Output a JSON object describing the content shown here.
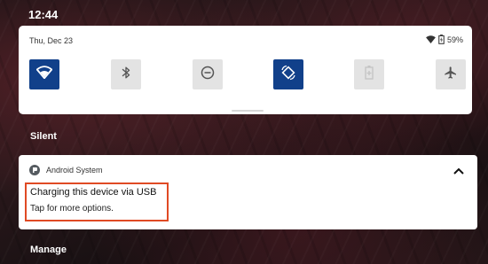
{
  "status_bar": {
    "time": "12:44"
  },
  "quick_settings": {
    "date": "Thu, Dec 23",
    "battery_percent": "59%",
    "tiles": [
      {
        "name": "wifi",
        "icon": "wifi-icon",
        "active": true
      },
      {
        "name": "bluetooth",
        "icon": "bluetooth-icon",
        "active": false
      },
      {
        "name": "do-not-disturb",
        "icon": "do-not-disturb-icon",
        "active": false
      },
      {
        "name": "auto-rotate",
        "icon": "auto-rotate-icon",
        "active": true
      },
      {
        "name": "battery-saver",
        "icon": "battery-saver-icon",
        "active": false
      },
      {
        "name": "airplane-mode",
        "icon": "airplane-icon",
        "active": false
      }
    ]
  },
  "sections": {
    "silent_label": "Silent",
    "manage_label": "Manage"
  },
  "notification": {
    "app_name": "Android System",
    "title": "Charging this device via USB",
    "text": "Tap for more options.",
    "expand_icon": "chevron-up-icon"
  },
  "colors": {
    "tile_active": "#11408a",
    "tile_inactive": "#e3e3e3",
    "highlight_border": "#e04a24",
    "panel_background": "#ffffff"
  }
}
